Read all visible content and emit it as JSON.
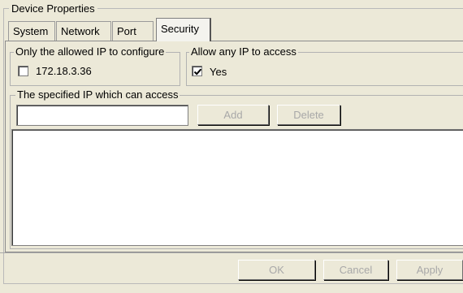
{
  "window": {
    "group_title": "Device Properties"
  },
  "tabs": [
    {
      "label": "System",
      "active": false
    },
    {
      "label": "Network",
      "active": false
    },
    {
      "label": "Port",
      "active": false
    },
    {
      "label": "Security",
      "active": true
    }
  ],
  "security": {
    "allowed_ip_group": {
      "title": "Only the allowed IP to configure",
      "checkbox_label": "172.18.3.36",
      "checked": false
    },
    "allow_any_group": {
      "title": "Allow any IP to access",
      "checkbox_label": "Yes",
      "checked": true
    },
    "specified_ip_group": {
      "title": "The specified IP which can access",
      "input_value": "",
      "add_label": "Add",
      "delete_label": "Delete",
      "list_items": []
    }
  },
  "footer": {
    "ok_label": "OK",
    "cancel_label": "Cancel",
    "apply_label": "Apply"
  },
  "colors": {
    "background": "#ece9d8",
    "disabled_text": "#a8a8a8"
  }
}
